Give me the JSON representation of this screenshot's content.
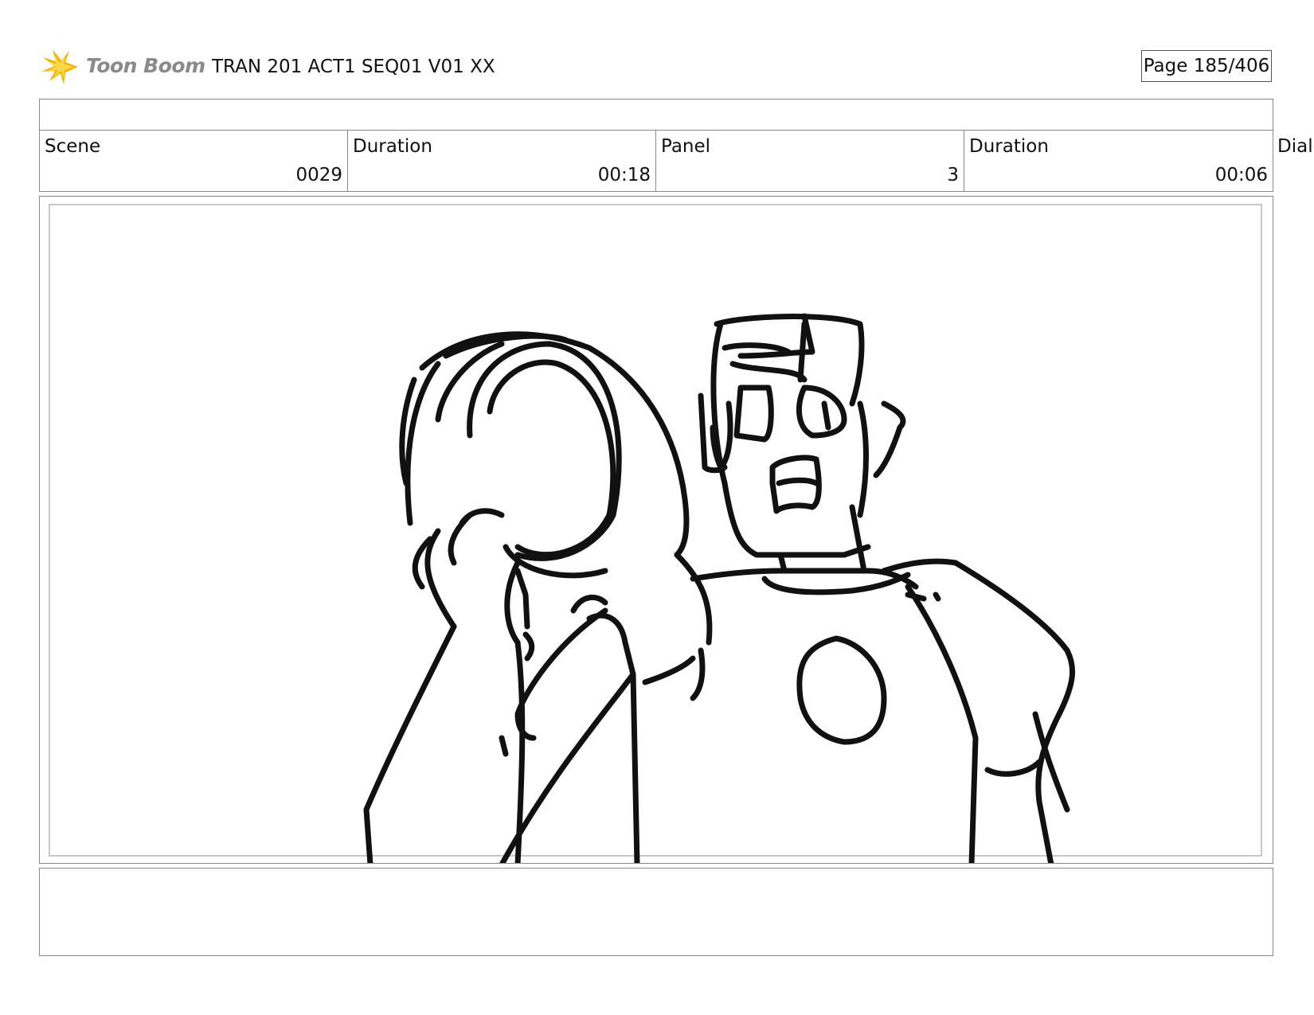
{
  "header": {
    "logo_text": "Toon Boom",
    "title": "TRAN 201 ACT1 SEQ01 V01 XX",
    "page": "Page 185/406"
  },
  "info": {
    "scene_label": "Scene",
    "scene_value": "0029",
    "scene_duration_label": "Duration",
    "scene_duration_value": "00:18",
    "panel_label": "Panel",
    "panel_value": "3",
    "panel_duration_label": "Duration",
    "panel_duration_value": "00:06",
    "dialog_label": "Dialog"
  },
  "colors": {
    "logo_star": "#f5b400",
    "sketch_ink": "#111111",
    "border": "#888888"
  }
}
